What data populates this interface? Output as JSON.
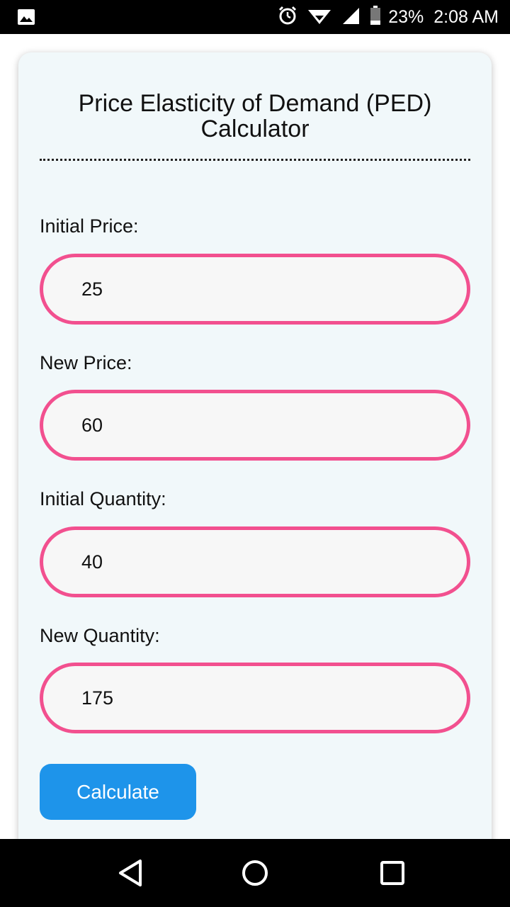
{
  "status_bar": {
    "battery": "23%",
    "time": "2:08 AM",
    "icons": [
      "image-notification-icon",
      "alarm-icon",
      "wifi-icon",
      "cell-signal-icon",
      "battery-icon"
    ]
  },
  "calculator": {
    "title_line1": "Price Elasticity of Demand (PED)",
    "title_line2": "Calculator",
    "fields": [
      {
        "label": "Initial Price:",
        "value": "25"
      },
      {
        "label": "New Price:",
        "value": "60"
      },
      {
        "label": "Initial Quantity:",
        "value": "40"
      },
      {
        "label": "New Quantity:",
        "value": "175"
      }
    ],
    "button_label": "Calculate"
  },
  "nav_bar": {
    "icons": [
      "back-icon",
      "home-icon",
      "recents-icon"
    ]
  },
  "colors": {
    "card_background": "#f1f8fa",
    "input_border": "#f2508f",
    "button_background": "#1e94ea",
    "bars": "#000000"
  }
}
